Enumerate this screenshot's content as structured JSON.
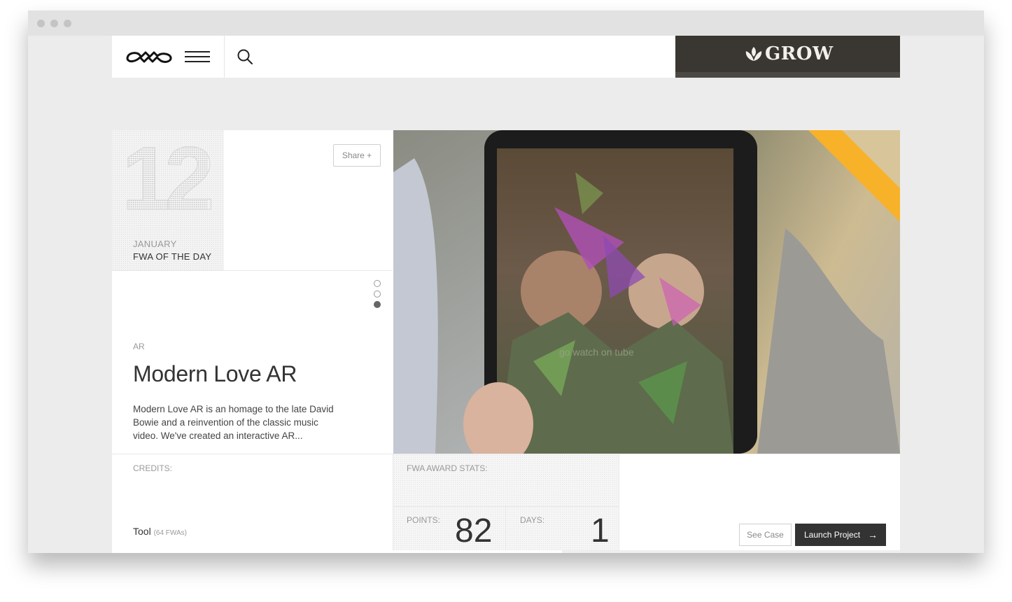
{
  "header": {
    "logo_label": "FWA",
    "ad_text": "GROW"
  },
  "date": {
    "day": "12",
    "month": "JANUARY",
    "label": "FWA OF THE DAY"
  },
  "share_label": "Share +",
  "project": {
    "category": "AR",
    "title": "Modern Love AR",
    "description": "Modern Love AR is an homage to the late David Bowie and a reinvention of the classic music video. We've created an interactive AR..."
  },
  "pager": {
    "total": 3,
    "active": 3
  },
  "hero_overlay_text": "go watch on tube",
  "credits": {
    "label": "CREDITS:",
    "tool": "Tool",
    "tool_count": "(64 FWAs)"
  },
  "stats": {
    "label": "FWA AWARD STATS:",
    "points_label": "POINTS:",
    "points": "82",
    "days_label": "DAYS:",
    "days": "1"
  },
  "actions": {
    "see_case": "See Case",
    "launch": "Launch Project"
  },
  "colors": {
    "ribbon": "#f7b22a",
    "ad_bg": "#3a3733",
    "launch_bg": "#333333"
  }
}
